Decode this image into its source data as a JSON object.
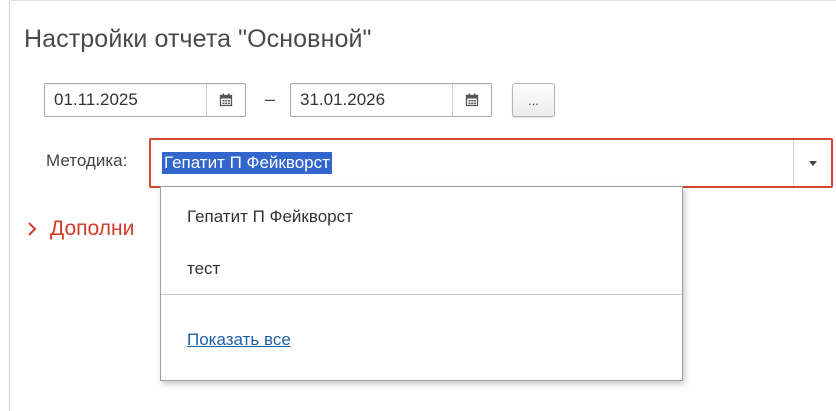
{
  "form": {
    "title": "Настройки отчета \"Основной\""
  },
  "period": {
    "start_date": "01.11.2025",
    "separator": "–",
    "end_date": "31.01.2026",
    "more_button_label": "..."
  },
  "method": {
    "label": "Методика:",
    "selected_value": "Гепатит П Фейкворст"
  },
  "section": {
    "label": "Дополни"
  },
  "dropdown": {
    "items": [
      "Гепатит П Фейкворст",
      "тест"
    ],
    "show_all_label": "Показать все"
  },
  "colors": {
    "selection": "#3366cc",
    "error_border": "#d9452f",
    "section_title": "#d23b2b",
    "link": "#1f5fa8"
  },
  "icons": {
    "date_picker": "calendar-icon",
    "dropdown": "triangle-down-icon",
    "section": "chevron-right-icon"
  }
}
